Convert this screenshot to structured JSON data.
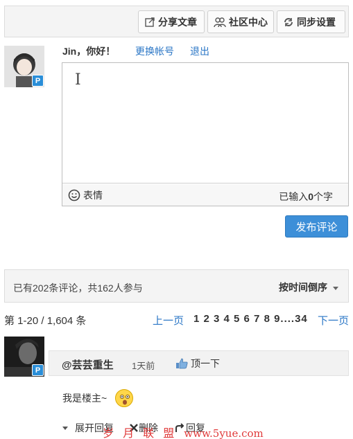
{
  "toolbar": {
    "share_label": "分享文章",
    "community_label": "社区中心",
    "sync_label": "同步设置"
  },
  "user": {
    "greeting": "Jin，你好！",
    "switch_account": "更换帐号",
    "logout": "退出",
    "badge": "P"
  },
  "editor": {
    "cursor": "I",
    "emoji_label": "表情",
    "count_prefix": "已输入",
    "count_value": "0",
    "count_suffix": "个字"
  },
  "publish_label": "发布评论",
  "stats": {
    "text": "已有202条评论，共162人参与",
    "sort_label": "按时间倒序"
  },
  "pager": {
    "info": "第 1-20 / 1,604 条",
    "prev": "上一页",
    "pages": "1 2 3 4 5 6 7 8 9....34",
    "next": "下一页"
  },
  "comment": {
    "author": "@芸芸重生",
    "time": "1天前",
    "upvote": "顶一下",
    "body": "我是楼主~",
    "actions": {
      "expand": "展开回复",
      "delete": "删除",
      "reply": "回复"
    }
  },
  "watermark": {
    "text": "岁 月 联 盟",
    "url": "www.5yue.com"
  },
  "colors": {
    "accent": "#3d8fd8",
    "link": "#2a76c6",
    "watermark": "#e03a3a"
  }
}
